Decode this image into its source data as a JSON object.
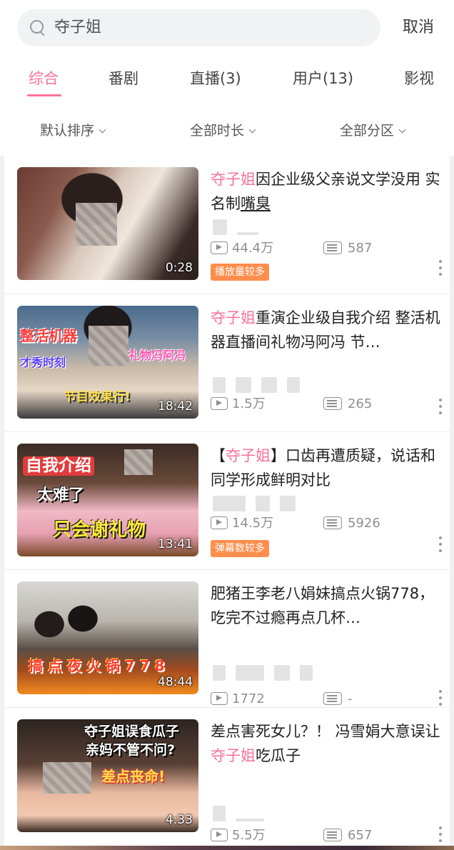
{
  "search": {
    "query": "夺子姐",
    "cancel_label": "取消"
  },
  "tabs": [
    {
      "label": "综合",
      "active": true
    },
    {
      "label": "番剧"
    },
    {
      "label": "直播(3)"
    },
    {
      "label": "用户(13)"
    },
    {
      "label": "影视"
    }
  ],
  "filters": [
    {
      "label": "默认排序"
    },
    {
      "label": "全部时长"
    },
    {
      "label": "全部分区"
    }
  ],
  "colors": {
    "accent": "#fb7299",
    "badge": "#ff8e4d",
    "text": "#212121",
    "muted": "#8f8f8f"
  },
  "videos": [
    {
      "title_parts": [
        "夺子姐",
        "因企业级父亲说文学没用 实名制",
        "嘴臭"
      ],
      "duration": "0:28",
      "views": "44.4万",
      "danmaku": "587",
      "badge": "播放量较多"
    },
    {
      "title_parts": [
        "夺子姐",
        "重演企业级自我介绍 整活机器直播间礼物冯阿冯 节…"
      ],
      "duration": "18:42",
      "views": "1.5万",
      "danmaku": "265",
      "thumb_text": {
        "a": "整活机器",
        "b": "节目效果行!",
        "c": "礼物冯阿冯",
        "d": "才秀时刻"
      }
    },
    {
      "title_parts": [
        "【",
        "夺子姐",
        "】口齿再遭质疑，说话和同学形成鲜明对比"
      ],
      "duration": "13:41",
      "views": "14.5万",
      "danmaku": "5926",
      "badge": "弹幕数较多",
      "thumb_text": {
        "a": "自我介绍",
        "b": "太难了",
        "c": "只会谢礼物"
      }
    },
    {
      "title_parts": [
        "肥猪王李老八娟妹搞点火锅778，吃完不过瘾再点几杯…"
      ],
      "duration": "48:44",
      "views": "1772",
      "danmaku": "-",
      "thumb_text": {
        "a": "搞 点 夜 火 锅 7 7 8"
      }
    },
    {
      "title_parts": [
        "差点害死女儿？！ 冯雪娟大意误让",
        "夺子姐",
        "吃瓜子"
      ],
      "duration": "4:33",
      "views": "5.5万",
      "danmaku": "657",
      "thumb_text": {
        "a": "夺子姐误食瓜子",
        "b": "亲妈不管不问?",
        "c": "差点丧命!"
      }
    }
  ]
}
